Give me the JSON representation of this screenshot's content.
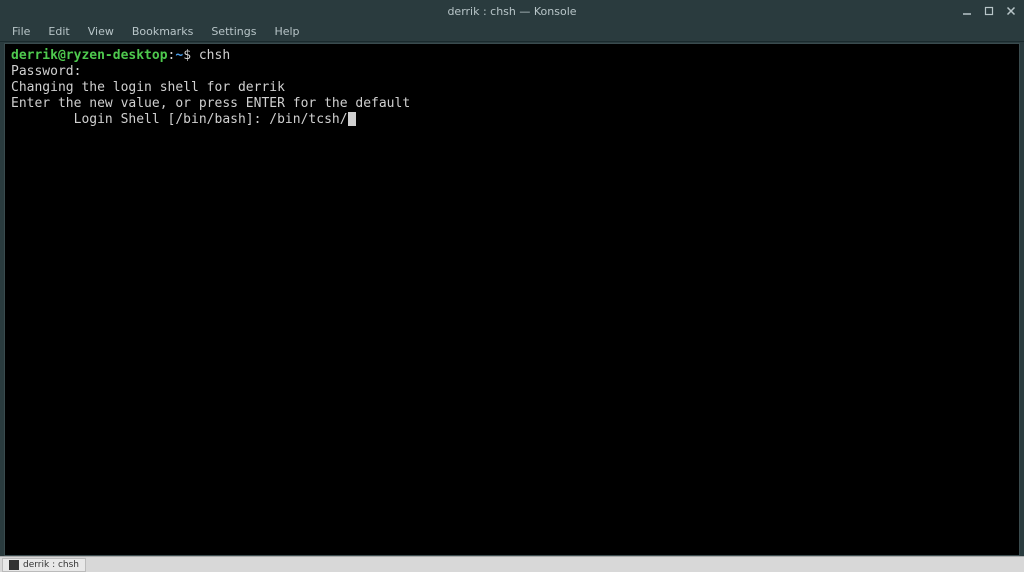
{
  "window": {
    "title": "derrik : chsh — Konsole"
  },
  "menubar": {
    "items": [
      "File",
      "Edit",
      "View",
      "Bookmarks",
      "Settings",
      "Help"
    ]
  },
  "terminal": {
    "prompt_user_host": "derrik@ryzen-desktop",
    "prompt_sep": ":",
    "prompt_path": "~",
    "prompt_end": "$",
    "command": "chsh",
    "lines": {
      "password": "Password:",
      "changing": "Changing the login shell for derrik",
      "enter": "Enter the new value, or press ENTER for the default",
      "login_prompt": "        Login Shell [/bin/bash]: ",
      "login_value": "/bin/tcsh/"
    }
  },
  "taskbar": {
    "item_label": "derrik : chsh"
  }
}
